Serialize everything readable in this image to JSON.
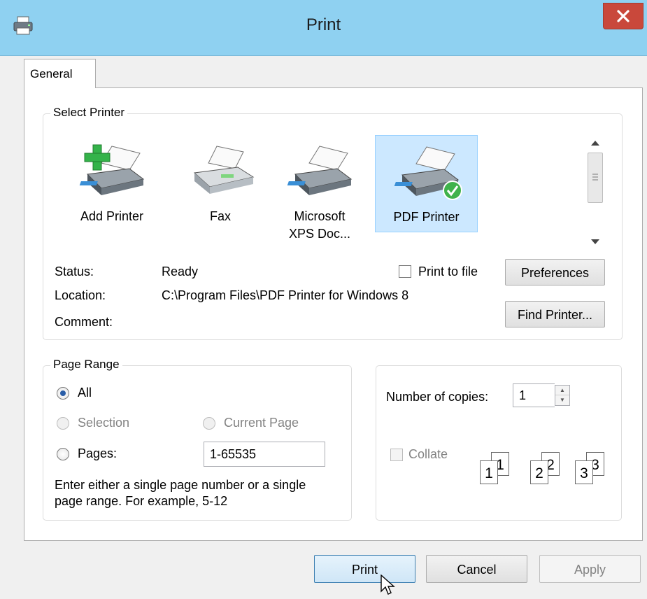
{
  "window": {
    "title": "Print",
    "close_icon": "close-icon"
  },
  "tabs": [
    {
      "label": "General"
    }
  ],
  "select_printer": {
    "legend": "Select Printer",
    "printers": [
      {
        "label": "Add Printer",
        "icon": "add-printer-icon"
      },
      {
        "label": "Fax",
        "icon": "fax-icon"
      },
      {
        "label_line1": "Microsoft",
        "label_line2": "XPS Doc...",
        "icon": "printer-icon"
      },
      {
        "label": "PDF Printer",
        "icon": "pdf-printer-icon",
        "selected": true
      }
    ],
    "status_label": "Status:",
    "status_value": "Ready",
    "location_label": "Location:",
    "location_value": "C:\\Program Files\\PDF Printer for Windows 8",
    "comment_label": "Comment:",
    "print_to_file_label": "Print to file",
    "preferences_button": "Preferences",
    "find_printer_button": "Find Printer..."
  },
  "page_range": {
    "legend": "Page Range",
    "all_label": "All",
    "selection_label": "Selection",
    "current_page_label": "Current Page",
    "pages_label": "Pages:",
    "pages_value": "1-65535",
    "hint_line1": "Enter either a single page number or a single",
    "hint_line2": "page range.  For example, 5-12"
  },
  "copies": {
    "label": "Number of copies:",
    "value": "1",
    "collate_label": "Collate",
    "collate_digits": [
      "1",
      "1",
      "2",
      "2",
      "3",
      "3"
    ]
  },
  "footer": {
    "print_button": "Print",
    "cancel_button": "Cancel",
    "apply_button": "Apply"
  },
  "colors": {
    "titlebar": "#8fd1f1",
    "close": "#c9483b",
    "selection": "#cce8ff",
    "accent": "#2a5ea8"
  }
}
